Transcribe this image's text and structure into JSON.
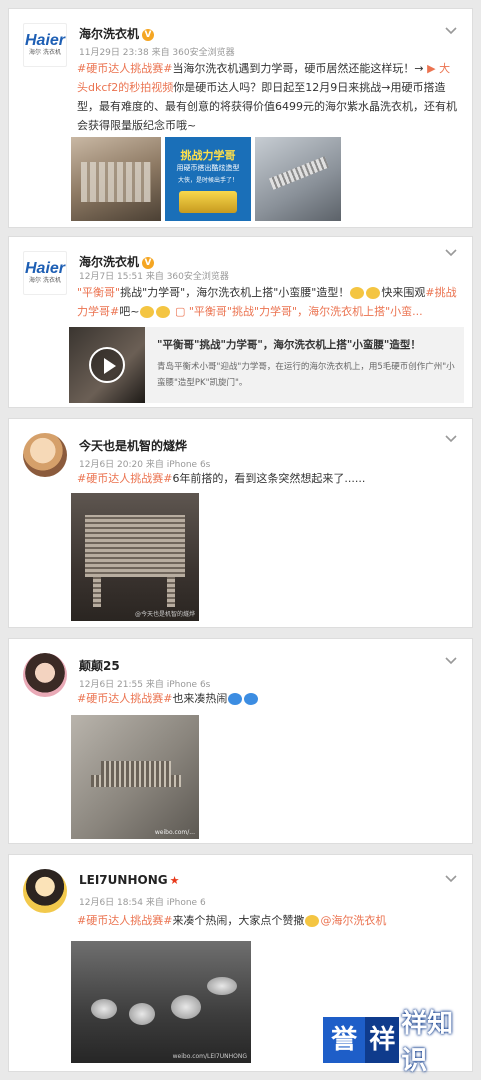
{
  "posts": [
    {
      "name": "海尔洗衣机",
      "verified": true,
      "meta": "11月29日 23:38 来自 360安全浏览器",
      "avatar": "haier-logo",
      "text_pre": "",
      "topic": "#硬币达人挑战赛#",
      "text": "当海尔洗衣机遇到力学哥，硬币居然还能这样玩！→",
      "link": "大头dkcf2的秒拍视频",
      "text2": "你是硬币达人吗？即日起至12月9日来挑战→用硬币搭造型，最有难度的、最有创意的将获得价值6499元的海尔紫水晶洗衣机，还有机会获得限量版纪念币哦~",
      "poster_text": [
        "挑战力学哥",
        "用硬币搭出酷炫造型",
        "大侠，是时候出手了！"
      ]
    },
    {
      "name": "海尔洗衣机",
      "verified": true,
      "meta": "12月7日 15:51 来自 360安全浏览器",
      "avatar": "haier-logo",
      "text_q1": "\"平衡哥\"",
      "text_a": "挑战\"力学哥\"，海尔洗衣机上搭\"小蛮腰\"造型！",
      "text_b": "快来围观",
      "topic": "#挑战力学哥#",
      "text_c": "吧~",
      "link": "\"平衡哥\"挑战\"力学哥\"，海尔洗衣机上搭\"小蛮...",
      "share_title": "\"平衡哥\"挑战\"力学哥\"，海尔洗衣机上搭\"小蛮腰\"造型！",
      "share_desc": "青岛平衡术小哥\"迎战\"力学哥，在运行的海尔洗衣机上，用5毛硬币创作广州\"小蛮腰\"造型PK\"凯旋门\"。"
    },
    {
      "name": "今天也是机智的燧烨",
      "meta": "12月6日 20:20 来自 iPhone 6s",
      "topic": "#硬币达人挑战赛#",
      "text": "6年前搭的，看到这条突然想起来了......",
      "photo_caption": "@今天也是机智的燧烨"
    },
    {
      "name": "颠颠25",
      "meta": "12月6日 21:55 来自 iPhone 6s",
      "topic": "#硬币达人挑战赛#",
      "text": "也来凑热闹",
      "photo_caption": "weibo.com/..."
    },
    {
      "name": "LEI7UNHONG",
      "meta": "12月6日 18:54 来自 iPhone 6",
      "topic": "#硬币达人挑战赛#",
      "text": "来凑个热闹，大家点个赞撒",
      "mention": "@海尔洗衣机",
      "photo_caption": "weibo.com/LEI7UNHONG"
    }
  ],
  "watermark": {
    "part1": "誉",
    "part2": "祥",
    "part3": "祥知识"
  }
}
